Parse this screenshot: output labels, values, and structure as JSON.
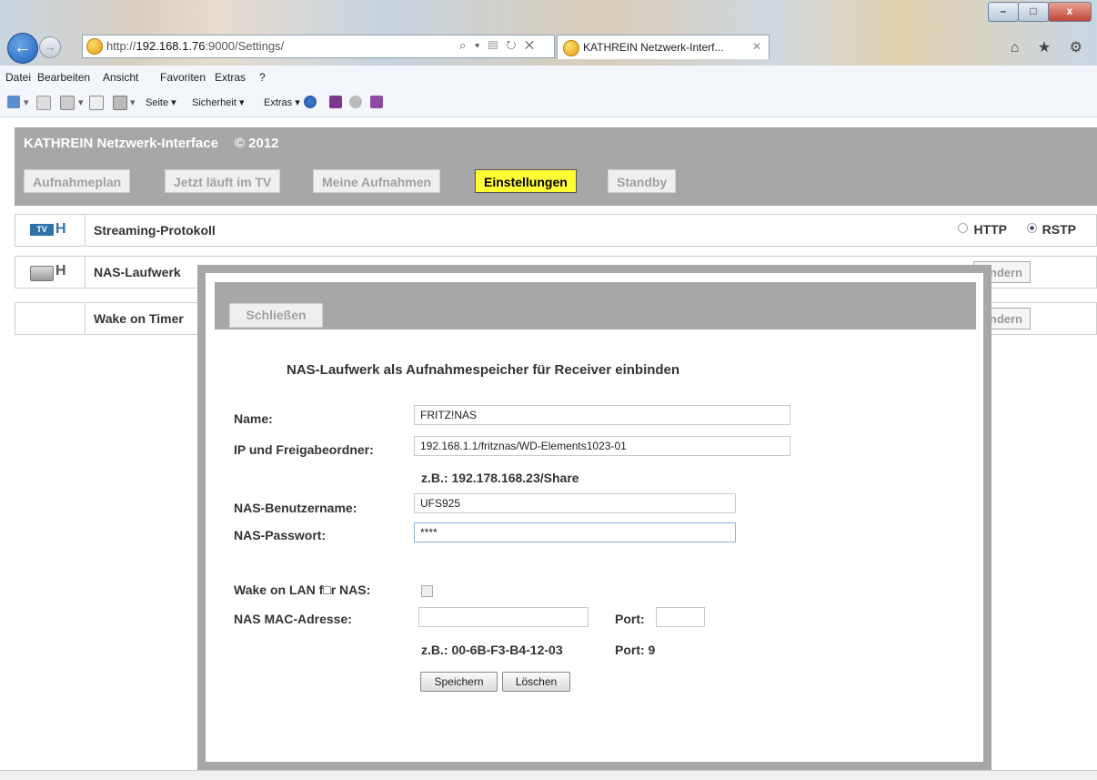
{
  "browser": {
    "url_prefix": "http://",
    "url_host": "192.168.1.76",
    "url_rest": ":9000/Settings/",
    "address_tools": "⌕ ▾ ▤ ↻ ✕",
    "tab_title": "KATHREIN Netzwerk-Interf...",
    "tab_close": "✕",
    "window_controls": [
      "–",
      "□",
      "x"
    ],
    "right_icons": "⌂ ★ ⚙"
  },
  "menubar": [
    "Datei",
    "Bearbeiten",
    "Ansicht",
    "Favoriten",
    "Extras",
    "?"
  ],
  "commandbar": {
    "seite": "Seite ▾",
    "sicherheit": "Sicherheit ▾",
    "extras": "Extras ▾"
  },
  "header": {
    "brand": "KATHREIN Netzwerk-Interface",
    "copyright": "© 2012",
    "nav": [
      {
        "label": "Aufnahmeplan",
        "active": false
      },
      {
        "label": "Jetzt läuft im TV",
        "active": false
      },
      {
        "label": "Meine Aufnahmen",
        "active": false
      },
      {
        "label": "Einstellungen",
        "active": true
      },
      {
        "label": "Standby",
        "active": false
      }
    ]
  },
  "settings": {
    "streaming": {
      "icon_text": "TV",
      "label": "Streaming-Protokoll",
      "options": [
        "HTTP",
        "RSTP"
      ],
      "selected": "RSTP"
    },
    "nas_label": "NAS-Laufwerk",
    "wake_label": "Wake on Timer",
    "change_label": "Ändern"
  },
  "modal": {
    "close_label": "Schließen",
    "title": "NAS-Laufwerk als Aufnahmespeicher für Receiver einbinden",
    "name_label": "Name:",
    "name_value": "FRITZ!NAS",
    "ip_label": "IP und Freigabeordner:",
    "ip_value": "192.168.1.1/fritznas/WD-Elements1023-01",
    "ip_hint": "z.B.: 192.178.168.23/Share",
    "user_label": "NAS-Benutzername:",
    "user_value": "UFS925",
    "pass_label": "NAS-Passwort:",
    "pass_value": "****",
    "wol_label": "Wake on LAN f□r NAS:",
    "wol_checked": false,
    "mac_label": "NAS MAC-Adresse:",
    "mac_value": "",
    "port_label": "Port:",
    "port_value": "",
    "mac_hint": "z.B.: 00-6B-F3-B4-12-03",
    "port_hint": "Port: 9",
    "save_label": "Speichern",
    "delete_label": "Löschen"
  }
}
